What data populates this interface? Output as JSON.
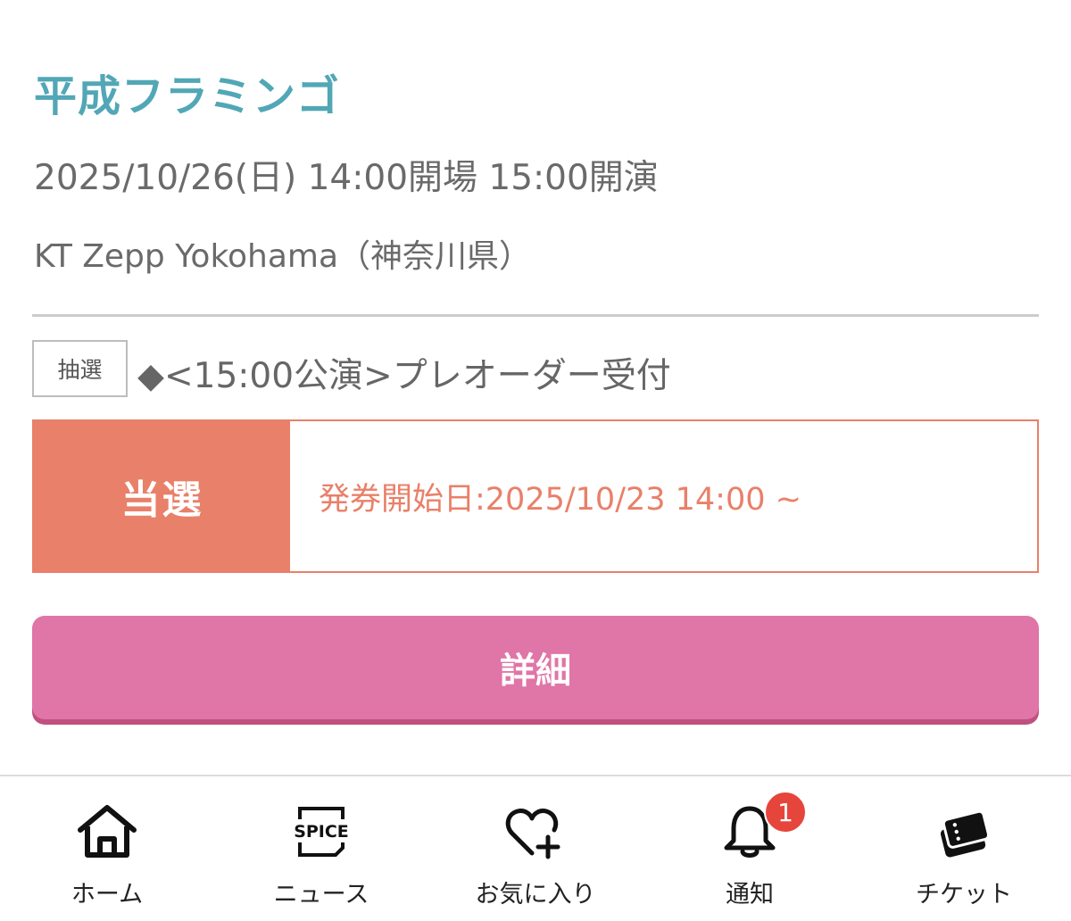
{
  "event": {
    "title": "平成フラミンゴ",
    "datetime": "2025/10/26(日) 14:00開場 15:00開演",
    "venue": "KT Zepp Yokohama（神奈川県）"
  },
  "reception": {
    "type_badge": "抽選",
    "name": "◆<15:00公演>プレオーダー受付"
  },
  "result": {
    "status": "当選",
    "detail": "発券開始日:2025/10/23 14:00 ~"
  },
  "detail_button": {
    "label": "詳細"
  },
  "bottom_nav": {
    "items": [
      {
        "label": "ホーム",
        "icon": "home-icon"
      },
      {
        "label": "ニュース",
        "icon": "spice-news-icon"
      },
      {
        "label": "お気に入り",
        "icon": "heart-plus-icon"
      },
      {
        "label": "通知",
        "icon": "bell-icon",
        "badge": "1"
      },
      {
        "label": "チケット",
        "icon": "ticket-icon"
      }
    ]
  },
  "colors": {
    "title": "#52a7b6",
    "accent_orange": "#e98069",
    "button_pink": "#e075a7",
    "badge_red": "#e6453c"
  }
}
